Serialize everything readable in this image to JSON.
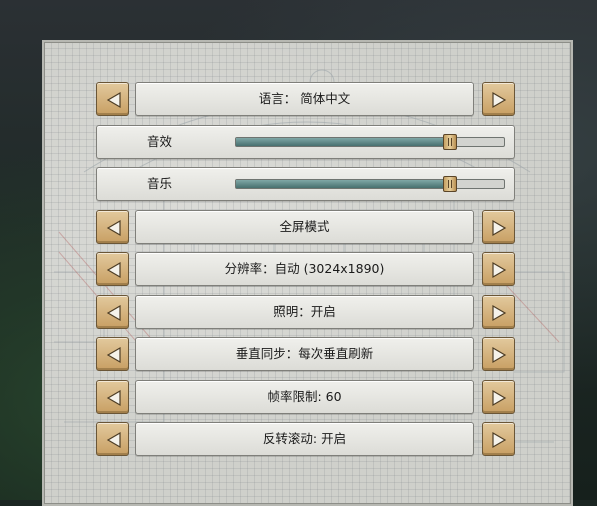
{
  "settings": {
    "rows": [
      {
        "type": "option",
        "label": "语言： 简体中文"
      },
      {
        "type": "slider",
        "label": "音效",
        "value": 0.8
      },
      {
        "type": "slider",
        "label": "音乐",
        "value": 0.8
      },
      {
        "type": "option",
        "label": "全屏模式"
      },
      {
        "type": "option",
        "label": "分辨率：自动 (3024x1890)"
      },
      {
        "type": "option",
        "label": "照明：开启"
      },
      {
        "type": "option",
        "label": "垂直同步：每次垂直刷新"
      },
      {
        "type": "option",
        "label": "帧率限制: 60"
      },
      {
        "type": "option",
        "label": "反转滚动: 开启"
      }
    ]
  },
  "icons": {
    "prev": "arrow-left-icon",
    "next": "arrow-right-icon"
  },
  "colors": {
    "arrow_button": "#d4b079",
    "slider_fill": "#5b8887",
    "panel": "#cfd0cb"
  }
}
